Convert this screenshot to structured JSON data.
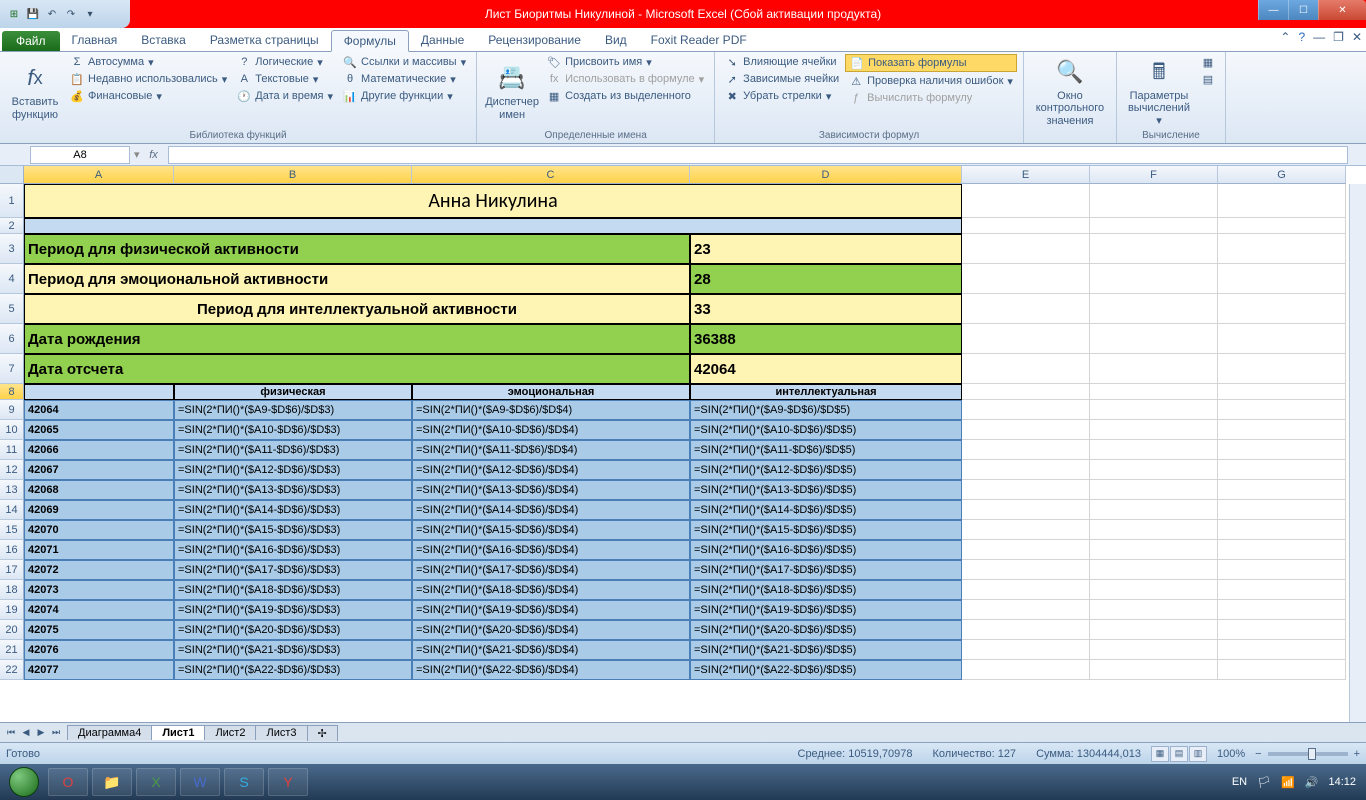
{
  "title": "Лист Биоритмы Никулиной  -  Microsoft Excel (Сбой активации продукта)",
  "tabs": {
    "file": "Файл",
    "items": [
      "Главная",
      "Вставка",
      "Разметка страницы",
      "Формулы",
      "Данные",
      "Рецензирование",
      "Вид",
      "Foxit Reader PDF"
    ],
    "active": 3
  },
  "ribbon": {
    "insert_function": "Вставить функцию",
    "autosum": "Автосумма",
    "recent": "Недавно использовались",
    "financial": "Финансовые",
    "logical": "Логические",
    "text": "Текстовые",
    "datetime": "Дата и время",
    "lookup": "Ссылки и массивы",
    "math": "Математические",
    "more": "Другие функции",
    "group_lib": "Библиотека функций",
    "name_mgr": "Диспетчер имен",
    "define_name": "Присвоить имя",
    "use_in_formula": "Использовать в формуле",
    "create_from_sel": "Создать из выделенного",
    "group_names": "Определенные имена",
    "trace_prec": "Влияющие ячейки",
    "trace_dep": "Зависимые ячейки",
    "remove_arrows": "Убрать стрелки",
    "show_formulas": "Показать формулы",
    "error_check": "Проверка наличия ошибок",
    "eval_formula": "Вычислить формулу",
    "group_audit": "Зависимости формул",
    "watch": "Окно контрольного значения",
    "calc_opts": "Параметры вычислений",
    "group_calc": "Вычисление"
  },
  "namebox": "A8",
  "fx_label": "fx",
  "col_headers": [
    "A",
    "B",
    "C",
    "D",
    "E",
    "F",
    "G"
  ],
  "data": {
    "title": "Анна Никулина",
    "r3": {
      "label": "Период для физической активности",
      "val": "23"
    },
    "r4": {
      "label": "Период для эмоциональной активности",
      "val": "28"
    },
    "r5": {
      "label": "Период для интеллектуальной активности",
      "val": "33"
    },
    "r6": {
      "label": "Дата рождения",
      "val": "36388"
    },
    "r7": {
      "label": "Дата отсчета",
      "val": "42064"
    },
    "sub_headers": [
      "физическая",
      "эмоциональная",
      "интеллектуальная"
    ],
    "rows": [
      {
        "rn": "9",
        "a": "42064",
        "b": "=SIN(2*ПИ()*($A9-$D$6)/$D$3)",
        "c": "=SIN(2*ПИ()*($A9-$D$6)/$D$4)",
        "d": "=SIN(2*ПИ()*($A9-$D$6)/$D$5)"
      },
      {
        "rn": "10",
        "a": "42065",
        "b": "=SIN(2*ПИ()*($A10-$D$6)/$D$3)",
        "c": "=SIN(2*ПИ()*($A10-$D$6)/$D$4)",
        "d": "=SIN(2*ПИ()*($A10-$D$6)/$D$5)"
      },
      {
        "rn": "11",
        "a": "42066",
        "b": "=SIN(2*ПИ()*($A11-$D$6)/$D$3)",
        "c": "=SIN(2*ПИ()*($A11-$D$6)/$D$4)",
        "d": "=SIN(2*ПИ()*($A11-$D$6)/$D$5)"
      },
      {
        "rn": "12",
        "a": "42067",
        "b": "=SIN(2*ПИ()*($A12-$D$6)/$D$3)",
        "c": "=SIN(2*ПИ()*($A12-$D$6)/$D$4)",
        "d": "=SIN(2*ПИ()*($A12-$D$6)/$D$5)"
      },
      {
        "rn": "13",
        "a": "42068",
        "b": "=SIN(2*ПИ()*($A13-$D$6)/$D$3)",
        "c": "=SIN(2*ПИ()*($A13-$D$6)/$D$4)",
        "d": "=SIN(2*ПИ()*($A13-$D$6)/$D$5)"
      },
      {
        "rn": "14",
        "a": "42069",
        "b": "=SIN(2*ПИ()*($A14-$D$6)/$D$3)",
        "c": "=SIN(2*ПИ()*($A14-$D$6)/$D$4)",
        "d": "=SIN(2*ПИ()*($A14-$D$6)/$D$5)"
      },
      {
        "rn": "15",
        "a": "42070",
        "b": "=SIN(2*ПИ()*($A15-$D$6)/$D$3)",
        "c": "=SIN(2*ПИ()*($A15-$D$6)/$D$4)",
        "d": "=SIN(2*ПИ()*($A15-$D$6)/$D$5)"
      },
      {
        "rn": "16",
        "a": "42071",
        "b": "=SIN(2*ПИ()*($A16-$D$6)/$D$3)",
        "c": "=SIN(2*ПИ()*($A16-$D$6)/$D$4)",
        "d": "=SIN(2*ПИ()*($A16-$D$6)/$D$5)"
      },
      {
        "rn": "17",
        "a": "42072",
        "b": "=SIN(2*ПИ()*($A17-$D$6)/$D$3)",
        "c": "=SIN(2*ПИ()*($A17-$D$6)/$D$4)",
        "d": "=SIN(2*ПИ()*($A17-$D$6)/$D$5)"
      },
      {
        "rn": "18",
        "a": "42073",
        "b": "=SIN(2*ПИ()*($A18-$D$6)/$D$3)",
        "c": "=SIN(2*ПИ()*($A18-$D$6)/$D$4)",
        "d": "=SIN(2*ПИ()*($A18-$D$6)/$D$5)"
      },
      {
        "rn": "19",
        "a": "42074",
        "b": "=SIN(2*ПИ()*($A19-$D$6)/$D$3)",
        "c": "=SIN(2*ПИ()*($A19-$D$6)/$D$4)",
        "d": "=SIN(2*ПИ()*($A19-$D$6)/$D$5)"
      },
      {
        "rn": "20",
        "a": "42075",
        "b": "=SIN(2*ПИ()*($A20-$D$6)/$D$3)",
        "c": "=SIN(2*ПИ()*($A20-$D$6)/$D$4)",
        "d": "=SIN(2*ПИ()*($A20-$D$6)/$D$5)"
      },
      {
        "rn": "21",
        "a": "42076",
        "b": "=SIN(2*ПИ()*($A21-$D$6)/$D$3)",
        "c": "=SIN(2*ПИ()*($A21-$D$6)/$D$4)",
        "d": "=SIN(2*ПИ()*($A21-$D$6)/$D$5)"
      },
      {
        "rn": "22",
        "a": "42077",
        "b": "=SIN(2*ПИ()*($A22-$D$6)/$D$3)",
        "c": "=SIN(2*ПИ()*($A22-$D$6)/$D$4)",
        "d": "=SIN(2*ПИ()*($A22-$D$6)/$D$5)"
      }
    ]
  },
  "sheet_tabs": [
    "Диаграмма4",
    "Лист1",
    "Лист2",
    "Лист3"
  ],
  "active_sheet": 1,
  "status": {
    "ready": "Готово",
    "avg": "Среднее: 10519,70978",
    "count": "Количество: 127",
    "sum": "Сумма: 1304444,013",
    "zoom": "100%"
  },
  "tray": {
    "lang": "EN",
    "time": "14:12"
  }
}
